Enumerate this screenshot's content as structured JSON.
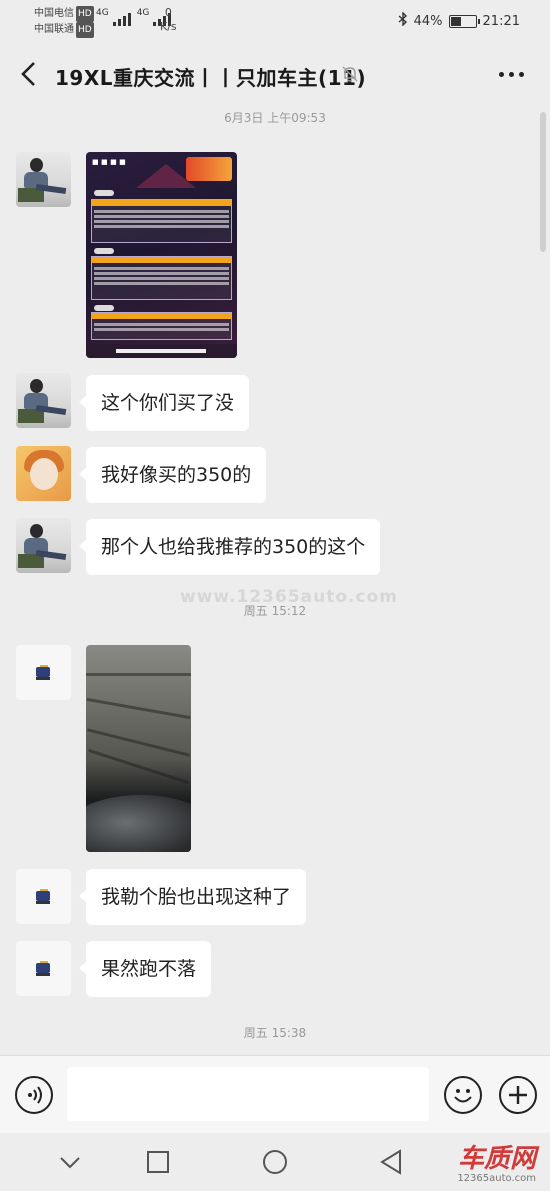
{
  "status": {
    "carrier1": "中国电信",
    "carrier2": "中国联通",
    "hd": "HD",
    "net1": "4G",
    "net2": "4G",
    "speed_value": "0",
    "speed_unit": "K/s",
    "battery": "44%",
    "battery_fraction": 0.44,
    "time": "21:21"
  },
  "header": {
    "title": "19XL重庆交流丨丨只加车主(11)"
  },
  "messages": {
    "ts1": "6月3日 上午09:53",
    "m1": "这个你们买了没",
    "m2": "我好像买的350的",
    "m3": "那个人也给我推荐的350的这个",
    "ts2": "周五 15:12",
    "m4": "我勒个胎也出现这种了",
    "m5": "果然跑不落",
    "ts3": "周五 15:38"
  },
  "watermark": "www.12365auto.com",
  "brand": {
    "logo": "车质网",
    "url": "12365auto.com"
  },
  "icons": {
    "back": "back-arrow-icon",
    "mute": "mute-bell-icon",
    "more": "more-dots-icon",
    "voice": "voice-icon",
    "emoji": "emoji-icon",
    "plus": "plus-icon"
  }
}
